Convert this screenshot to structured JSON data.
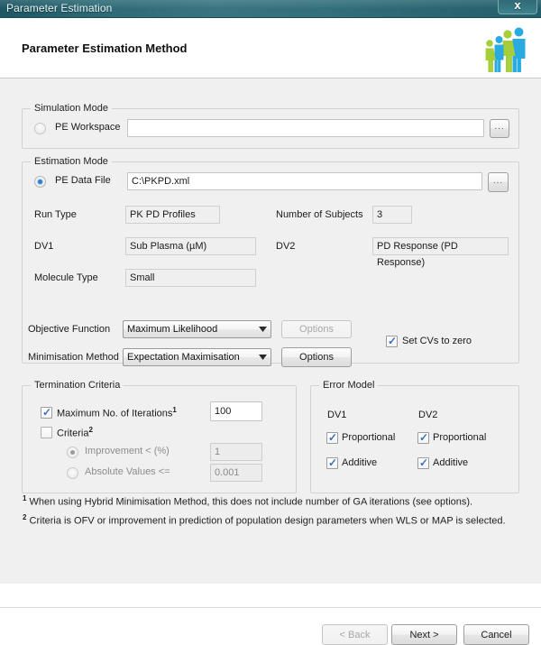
{
  "window": {
    "title": "Parameter Estimation",
    "close_label": "x"
  },
  "header": {
    "title": "Parameter Estimation Method",
    "logo_name": "family-group-logo"
  },
  "simulation_mode": {
    "legend": "Simulation Mode",
    "pe_workspace_label": "PE Workspace",
    "pe_workspace_value": "",
    "pe_workspace_selected": false,
    "browse_label": "..."
  },
  "estimation_mode": {
    "legend": "Estimation Mode",
    "pe_data_file_label": "PE Data File",
    "pe_data_file_value": "C:\\PKPD.xml",
    "pe_data_file_selected": true,
    "browse_label": "...",
    "fields": {
      "run_type_label": "Run Type",
      "run_type_value": "PK PD Profiles",
      "number_of_subjects_label": "Number of Subjects",
      "number_of_subjects_value": "3",
      "dv1_label": "DV1",
      "dv1_value": "Sub Plasma (µM)",
      "dv2_label": "DV2",
      "dv2_value": "PD Response (PD Response)",
      "molecule_type_label": "Molecule Type",
      "molecule_type_value": "Small"
    }
  },
  "methods": {
    "objective_function_label": "Objective Function",
    "objective_function_value": "Maximum Likelihood",
    "objective_function_options_label": "Options",
    "objective_function_options_enabled": false,
    "minimisation_method_label": "Minimisation Method",
    "minimisation_method_value": "Expectation Maximisation",
    "minimisation_method_options_label": "Options",
    "minimisation_method_options_enabled": true,
    "set_cvs_to_zero_label": "Set CVs to zero",
    "set_cvs_to_zero_checked": true
  },
  "termination_criteria": {
    "legend": "Termination Criteria",
    "max_iterations_label": "Maximum No. of Iterations",
    "max_iterations_sup": "1",
    "max_iterations_checked": true,
    "max_iterations_value": "100",
    "criteria_label": "Criteria",
    "criteria_sup": "2",
    "criteria_checked": false,
    "improvement_label": "Improvement < (%)",
    "improvement_value": "1",
    "improvement_selected": true,
    "absolute_values_label": "Absolute Values <=",
    "absolute_values_value": "0.001",
    "absolute_values_selected": false
  },
  "error_model": {
    "legend": "Error Model",
    "dv1_label": "DV1",
    "dv2_label": "DV2",
    "dv1_proportional_label": "Proportional",
    "dv1_proportional_checked": true,
    "dv1_additive_label": "Additive",
    "dv1_additive_checked": true,
    "dv2_proportional_label": "Proportional",
    "dv2_proportional_checked": true,
    "dv2_additive_label": "Additive",
    "dv2_additive_checked": true
  },
  "footnotes": {
    "note1_sup": "1",
    "note1": "When using Hybrid Minimisation Method, this does not include number of GA iterations (see options).",
    "note2_sup": "2",
    "note2": "Criteria is OFV or improvement in prediction of population design parameters when WLS or MAP is selected."
  },
  "footer": {
    "back_label": "< Back",
    "back_enabled": false,
    "next_label": "Next >",
    "next_enabled": true,
    "cancel_label": "Cancel",
    "cancel_enabled": true
  },
  "colors": {
    "titlebar_dark": "#1d5763",
    "titlebar_light": "#3a7480",
    "body_bg": "#f0f0f0",
    "accent_blue": "#2b7fd0",
    "logo_green": "#a6ce39",
    "logo_blue": "#29abe2",
    "check_blue": "#3a6fbd"
  }
}
